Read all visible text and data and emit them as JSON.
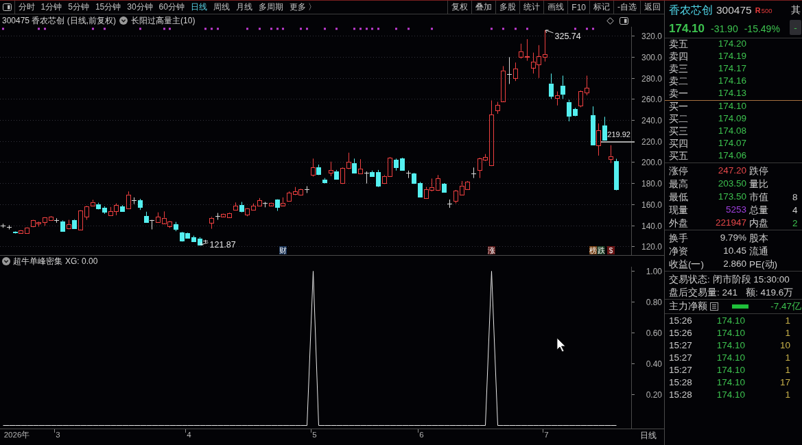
{
  "toolbar": {
    "periods": [
      {
        "label": "分时",
        "selected": false
      },
      {
        "label": "1分钟",
        "selected": false
      },
      {
        "label": "5分钟",
        "selected": false
      },
      {
        "label": "15分钟",
        "selected": false
      },
      {
        "label": "30分钟",
        "selected": false
      },
      {
        "label": "60分钟",
        "selected": false
      },
      {
        "label": "日线",
        "selected": true
      },
      {
        "label": "周线",
        "selected": false
      },
      {
        "label": "月线",
        "selected": false
      },
      {
        "label": "多周期",
        "selected": false
      },
      {
        "label": "更多 〉",
        "selected": false
      }
    ],
    "actions": [
      "复权",
      "叠加",
      "多股",
      "统计",
      "画线",
      "F10",
      "标记",
      "-自选",
      "返回"
    ]
  },
  "main_chart": {
    "title": "300475 香农芯创 (日线,前复权)",
    "indicator": "长阳过高量主(10)",
    "chart_data": [
      {
        "type": "candlestick",
        "grid": true,
        "ylim": [
          112,
          329
        ],
        "yticks": [
          {
            "value": 120,
            "label": "120.0"
          },
          {
            "value": 140,
            "label": "140.0"
          },
          {
            "value": 160,
            "label": "160.0"
          },
          {
            "value": 180,
            "label": "180.0"
          },
          {
            "value": 200,
            "label": "200.0"
          },
          {
            "value": 220,
            "label": "220.0"
          },
          {
            "value": 240,
            "label": "240.0"
          },
          {
            "value": 260,
            "label": "260.0"
          },
          {
            "value": 280,
            "label": "280.0"
          },
          {
            "value": 300,
            "label": "300.0"
          },
          {
            "value": 320,
            "label": "320.0"
          }
        ],
        "ref_lines": [
          {
            "axis": "y",
            "value": 219.92,
            "label": "219.92",
            "color": "#a8a8a8"
          }
        ],
        "categories": [
          null,
          null,
          null,
          null,
          null,
          null,
          null,
          null,
          null,
          null,
          null,
          null,
          null,
          null,
          null,
          null,
          null,
          null,
          null,
          null,
          null,
          null,
          null,
          null,
          null,
          null,
          null,
          null,
          null,
          null,
          null,
          null,
          null,
          null,
          null,
          null,
          null,
          null,
          null,
          null,
          null,
          null,
          null,
          null,
          null,
          null,
          null,
          null,
          null,
          null,
          null,
          null,
          null,
          null,
          null,
          null,
          null,
          null,
          null,
          null,
          null,
          null,
          null,
          null,
          null,
          null,
          null,
          null,
          null,
          null,
          null,
          null,
          null,
          null,
          null,
          null,
          null,
          null,
          null,
          null,
          null,
          null,
          null,
          null,
          null,
          null,
          null,
          null,
          null,
          null,
          null,
          null,
          null,
          null,
          null,
          null,
          null,
          null,
          null,
          null,
          null,
          null,
          null,
          null,
          null,
          null
        ],
        "ohlc": [
          [
            139.9,
            141.8,
            137.9,
            139.9
          ],
          [
            138.4,
            140.4,
            136.4,
            138.4
          ],
          [
            133.9,
            134.5,
            132.5,
            133.0
          ],
          [
            133.3,
            135.9,
            133.0,
            135.6
          ],
          [
            132.8,
            138.4,
            132.5,
            138.1
          ],
          [
            139.0,
            145.5,
            138.5,
            145.0
          ],
          [
            142.4,
            144.0,
            139.0,
            143.5
          ],
          [
            143.5,
            148.0,
            139.8,
            147.8
          ],
          [
            145.0,
            149.0,
            144.5,
            148.4
          ],
          [
            145.0,
            147.0,
            142.7,
            145.0
          ],
          [
            144.1,
            145.0,
            134.5,
            135.0
          ],
          [
            137.0,
            145.5,
            136.5,
            141.2
          ],
          [
            145.5,
            146.1,
            137.5,
            137.8
          ],
          [
            136.4,
            154.9,
            136.2,
            154.6
          ],
          [
            148.4,
            158.8,
            145.5,
            158.3
          ],
          [
            159.1,
            164.5,
            158.8,
            162.5
          ],
          [
            160.5,
            161.7,
            155.4,
            156.6
          ],
          [
            157.1,
            158.3,
            151.2,
            153.2
          ],
          [
            149.8,
            157.7,
            149.2,
            153.5
          ],
          [
            153.5,
            161.1,
            149.8,
            159.4
          ],
          [
            158.3,
            159.4,
            153.8,
            154.0
          ],
          [
            156.3,
            172.5,
            156.0,
            169.6
          ],
          [
            163.9,
            166.8,
            160.5,
            163.9
          ],
          [
            163.9,
            165.4,
            154.9,
            157.7
          ],
          [
            149.2,
            153.2,
            142.7,
            143.5
          ],
          [
            144.9,
            145.5,
            136.4,
            144.9
          ],
          [
            143.5,
            152.6,
            143.0,
            148.4
          ],
          [
            142.4,
            153.5,
            141.5,
            147.5
          ],
          [
            139.8,
            144.5,
            137.8,
            144.1
          ],
          [
            141.2,
            143.5,
            134.7,
            136.4
          ],
          [
            133.3,
            134.0,
            124.8,
            125.7
          ],
          [
            132.8,
            133.3,
            128.0,
            128.2
          ],
          [
            129.0,
            130.5,
            125.0,
            125.4
          ],
          [
            127.9,
            129.0,
            121.87,
            122.0
          ],
          [
            125.1,
            126.5,
            123.4,
            125.1
          ],
          [
            142.7,
            148.4,
            137.0,
            147.5
          ],
          [
            148.9,
            152.0,
            145.5,
            148.9
          ],
          [
            148.9,
            151.5,
            148.0,
            151.2
          ],
          [
            148.1,
            152.5,
            147.5,
            152.0
          ],
          [
            154.9,
            162.0,
            154.5,
            158.8
          ],
          [
            159.4,
            162.5,
            152.6,
            153.7
          ],
          [
            150.3,
            156.6,
            148.9,
            156.3
          ],
          [
            154.9,
            161.1,
            154.5,
            158.8
          ],
          [
            158.8,
            166.2,
            158.3,
            163.9
          ],
          [
            161.1,
            162.5,
            157.4,
            161.1
          ],
          [
            159.4,
            162.0,
            159.0,
            161.7
          ],
          [
            164.5,
            165.0,
            154.0,
            157.4
          ],
          [
            159.4,
            166.8,
            159.0,
            161.7
          ],
          [
            163.4,
            172.5,
            163.0,
            171.0
          ],
          [
            169.6,
            176.7,
            169.0,
            172.5
          ],
          [
            169.0,
            175.0,
            168.5,
            174.5
          ],
          [
            174.5,
            177.5,
            171.0,
            174.5
          ],
          [
            188.1,
            203.7,
            186.6,
            195.2
          ],
          [
            195.2,
            198.0,
            188.0,
            188.9
          ],
          [
            183.8,
            185.2,
            180.1,
            181.0
          ],
          [
            190.1,
            200.8,
            187.0,
            192.9
          ],
          [
            191.8,
            192.9,
            183.8,
            184.4
          ],
          [
            180.4,
            195.2,
            179.6,
            194.6
          ],
          [
            194.6,
            209.3,
            193.7,
            200.3
          ],
          [
            199.4,
            203.7,
            189.5,
            190.3
          ],
          [
            189.5,
            203.1,
            188.9,
            194.3
          ],
          [
            190.0,
            191.5,
            180.0,
            190.0
          ],
          [
            190.9,
            192.3,
            187.2,
            187.2
          ],
          [
            190.9,
            192.9,
            176.7,
            177.6
          ],
          [
            180.4,
            188.1,
            179.6,
            187.2
          ],
          [
            187.2,
            205.1,
            186.6,
            204.5
          ],
          [
            202.3,
            203.7,
            192.3,
            195.2
          ],
          [
            203.7,
            204.5,
            192.3,
            192.9
          ],
          [
            190.0,
            192.3,
            185.2,
            190.0
          ],
          [
            189.5,
            190.1,
            179.6,
            180.4
          ],
          [
            180.4,
            181.5,
            166.8,
            167.4
          ],
          [
            166.2,
            176.7,
            165.4,
            174.7
          ],
          [
            174.0,
            184.7,
            172.5,
            176.8
          ],
          [
            173.9,
            188.1,
            173.0,
            184.7
          ],
          [
            179.6,
            180.4,
            171.5,
            171.9
          ],
          [
            160.5,
            164.8,
            156.9,
            160.5
          ],
          [
            163.4,
            173.9,
            161.1,
            173.0
          ],
          [
            169.6,
            182.4,
            169.0,
            178.1
          ],
          [
            174.7,
            182.4,
            174.0,
            181.8
          ],
          [
            189.4,
            195.2,
            185.2,
            189.4
          ],
          [
            192.3,
            204.5,
            185.2,
            203.7
          ],
          [
            202.3,
            208.0,
            201.4,
            205.1
          ],
          [
            197.4,
            259.0,
            196.6,
            245.4
          ],
          [
            249.6,
            257.6,
            246.2,
            254.7
          ],
          [
            258.4,
            291.6,
            257.6,
            287.4
          ],
          [
            283.7,
            300.1,
            274.6,
            283.7
          ],
          [
            280.3,
            295.0,
            277.4,
            289.4
          ],
          [
            300.7,
            312.9,
            298.7,
            305.8
          ],
          [
            300.4,
            317.2,
            296.7,
            300.9
          ],
          [
            290.2,
            304.4,
            284.5,
            295.9
          ],
          [
            293.0,
            311.5,
            280.3,
            300.7
          ],
          [
            300.1,
            325.74,
            295.9,
            303.0
          ],
          [
            275.2,
            284.5,
            260.4,
            263.2
          ],
          [
            261.0,
            267.5,
            254.2,
            263.8
          ],
          [
            273.2,
            282.5,
            260.4,
            265.5
          ],
          [
            257.6,
            259.6,
            239.1,
            244.5
          ],
          [
            250.5,
            251.9,
            243.9,
            244.5
          ],
          [
            253.9,
            268.4,
            252.5,
            267.5
          ],
          [
            266.1,
            282.5,
            263.8,
            270.9
          ],
          [
            244.8,
            253.3,
            216.5,
            217.0
          ],
          [
            216.4,
            237.1,
            206.5,
            230.6
          ],
          [
            234.9,
            243.4,
            220.7,
            221.5
          ],
          [
            203.1,
            216.4,
            199.4,
            206.0
          ],
          [
            201.0,
            203.5,
            173.5,
            174.1
          ],
          null,
          null
        ]
      }
    ],
    "signals": [
      true,
      false,
      false,
      false,
      false,
      false,
      true,
      true,
      false,
      false,
      false,
      false,
      false,
      false,
      false,
      true,
      false,
      true,
      false,
      false,
      false,
      false,
      false,
      true,
      false,
      false,
      false,
      true,
      true,
      false,
      false,
      false,
      false,
      false,
      true,
      true,
      true,
      false,
      false,
      false,
      false,
      true,
      false,
      true,
      false,
      true,
      true,
      true,
      false,
      false,
      true,
      true,
      false,
      false,
      true,
      false,
      true,
      false,
      false,
      true,
      true,
      true,
      true,
      true,
      false,
      false,
      true,
      false,
      true,
      false,
      false,
      false,
      true,
      false,
      false,
      false,
      false,
      false,
      false,
      false,
      false,
      false,
      true,
      false,
      true,
      false,
      true,
      false,
      true,
      false,
      false,
      false,
      false,
      false,
      false,
      false,
      true,
      false,
      true,
      true,
      false,
      false,
      false,
      false
    ],
    "extreme_labels": [
      {
        "kind": "high",
        "text": "325.74"
      },
      {
        "kind": "low",
        "text": "121.87"
      }
    ],
    "event_marks": [
      {
        "text": "财",
        "color": "#1b3458"
      },
      {
        "text": "涨",
        "color": "#5e1d1d"
      },
      {
        "text": "榜",
        "color": "#7a4418"
      },
      {
        "text": "跌",
        "color": "#1e4026"
      },
      {
        "text": "$",
        "color": "#6a1414"
      }
    ]
  },
  "sub_chart": {
    "title": "超牛单峰密集",
    "reading": "XG: 0.00",
    "chart_data": [
      {
        "type": "line",
        "color": "#e8e8e8",
        "ylim": [
          -0.02,
          1.029
        ],
        "yticks": [
          {
            "value": 0.2,
            "label": "0.20"
          },
          {
            "value": 0.4,
            "label": "0.40"
          },
          {
            "value": 0.6,
            "label": "0.60"
          },
          {
            "value": 0.8,
            "label": "0.80"
          },
          {
            "value": 1,
            "label": "1.00"
          }
        ],
        "categories": [
          null,
          null,
          "2026年",
          null,
          null,
          null,
          null,
          null,
          null,
          "3",
          null,
          null,
          null,
          null,
          null,
          null,
          null,
          null,
          null,
          null,
          null,
          null,
          null,
          null,
          null,
          null,
          null,
          null,
          null,
          null,
          null,
          "4",
          null,
          null,
          null,
          null,
          null,
          null,
          null,
          null,
          null,
          null,
          null,
          null,
          null,
          null,
          null,
          null,
          null,
          null,
          null,
          null,
          "5",
          null,
          null,
          null,
          null,
          null,
          null,
          null,
          null,
          null,
          null,
          null,
          null,
          null,
          null,
          null,
          null,
          null,
          "6",
          null,
          null,
          null,
          null,
          null,
          null,
          null,
          null,
          null,
          null,
          null,
          null,
          null,
          null,
          null,
          null,
          null,
          null,
          null,
          null,
          "7",
          null,
          null,
          null,
          null,
          null,
          null,
          null,
          null,
          null,
          null,
          null,
          null,
          null,
          null
        ],
        "values": [
          0,
          0,
          0,
          0,
          0,
          0,
          0,
          0,
          0,
          0,
          0,
          0,
          0,
          0,
          0,
          0,
          0,
          0,
          0,
          0,
          0,
          0,
          0,
          0,
          0,
          0,
          0,
          0,
          0,
          0,
          0,
          0,
          0,
          0,
          0,
          0,
          0,
          0,
          0,
          0,
          0,
          0,
          0,
          0,
          0,
          0,
          0,
          0,
          0,
          0,
          0,
          0,
          1,
          0,
          0,
          0,
          0,
          0,
          0,
          0,
          0,
          0,
          0,
          0,
          0,
          0,
          0,
          0,
          0,
          0,
          0,
          0,
          0,
          0,
          0,
          0,
          0,
          0,
          0,
          0,
          0,
          0,
          1,
          0,
          0,
          0,
          0,
          0,
          0,
          0,
          0,
          0,
          0,
          0,
          0,
          0,
          0,
          0,
          0,
          0,
          0,
          0,
          0,
          0,
          null,
          null
        ]
      }
    ]
  },
  "period_label": "日线",
  "quote": {
    "name": "香农芯创",
    "code": "300475",
    "rating": "R",
    "rating_value": "500",
    "side_tab": "其",
    "side_value": "-",
    "price": "174.10",
    "change": "-31.90",
    "change_pct": "-15.49%",
    "asks": [
      {
        "label": "卖五",
        "price": "174.20"
      },
      {
        "label": "卖四",
        "price": "174.19"
      },
      {
        "label": "卖三",
        "price": "174.17"
      },
      {
        "label": "卖二",
        "price": "174.16"
      },
      {
        "label": "卖一",
        "price": "174.13"
      }
    ],
    "bids": [
      {
        "label": "买一",
        "price": "174.10"
      },
      {
        "label": "买二",
        "price": "174.09"
      },
      {
        "label": "买三",
        "price": "174.08"
      },
      {
        "label": "买四",
        "price": "174.07"
      },
      {
        "label": "买五",
        "price": "174.06"
      }
    ],
    "stats": [
      {
        "label": "涨停",
        "value": "247.20",
        "color": "#e8484a"
      },
      {
        "label": "跌停"
      },
      {
        "label": "最高",
        "value": "203.50",
        "color": "#3dc24f"
      },
      {
        "label": "量比"
      },
      {
        "label": "最低",
        "value": "173.50",
        "color": "#3dc24f"
      },
      {
        "label": "市值",
        "value": "8",
        "color": "#cdcdcd"
      },
      {
        "label": "现量",
        "value": "5253",
        "color": "#a040e0"
      },
      {
        "label": "总量",
        "value": "4",
        "color": "#cdcdcd"
      },
      {
        "label": "外盘",
        "value": "221947",
        "color": "#e8484a"
      },
      {
        "label": "内盘",
        "value": "2",
        "color": "#3dc24f"
      }
    ],
    "fundamentals": [
      {
        "label": "换手",
        "value": "9.79%"
      },
      {
        "label": "股本"
      },
      {
        "label": "净资",
        "value": "10.45"
      },
      {
        "label": "流通"
      },
      {
        "label": "收益(一)",
        "value": "2.860"
      },
      {
        "label": "PE(动)"
      }
    ],
    "session": {
      "status": "交易状态: 闭市阶段 15:30:00",
      "after_hours_volume": "盘后交易量: 241",
      "after_hours_amount": "额: 419.6万"
    },
    "net_flow": {
      "label": "主力净额",
      "value": "-7.47亿"
    },
    "trades": [
      {
        "time": "15:26",
        "price": "174.10",
        "volume": "1"
      },
      {
        "time": "15:26",
        "price": "174.10",
        "volume": "1"
      },
      {
        "time": "15:27",
        "price": "174.10",
        "volume": "10"
      },
      {
        "time": "15:27",
        "price": "174.10",
        "volume": "1"
      },
      {
        "time": "15:27",
        "price": "174.10",
        "volume": "1"
      },
      {
        "time": "15:28",
        "price": "174.10",
        "volume": "17"
      },
      {
        "time": "15:28",
        "price": "174.10",
        "volume": "1"
      }
    ]
  }
}
